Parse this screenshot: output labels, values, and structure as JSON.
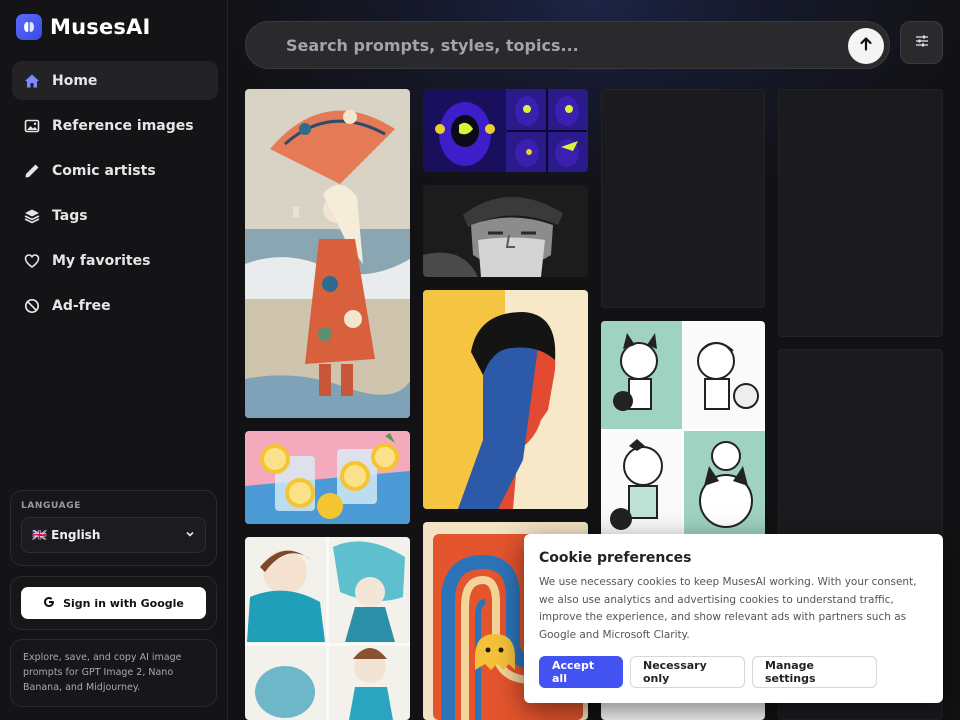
{
  "brand": {
    "name": "MusesAI"
  },
  "nav": [
    {
      "label": "Home",
      "icon": "home-icon",
      "active": true
    },
    {
      "label": "Reference images",
      "icon": "image-icon"
    },
    {
      "label": "Comic artists",
      "icon": "pencil-icon"
    },
    {
      "label": "Tags",
      "icon": "layers-icon"
    },
    {
      "label": "My favorites",
      "icon": "heart-icon"
    },
    {
      "label": "Ad-free",
      "icon": "ban-icon"
    }
  ],
  "language": {
    "label": "LANGUAGE",
    "selected": "🇬🇧 English"
  },
  "auth": {
    "signin_label": "Sign in with Google"
  },
  "about": {
    "text": "Explore, save, and copy AI image prompts for GPT Image 2, Nano Banana, and Midjourney."
  },
  "search": {
    "placeholder": "Search prompts, styles, topics..."
  },
  "cookie": {
    "title": "Cookie preferences",
    "text": "We use necessary cookies to keep MusesAI working. With your consent, we also use analytics and advertising cookies to understand traffic, improve the experience, and show relevant ads with partners such as Google and Microsoft Clarity.",
    "accept_label": "Accept all",
    "necessary_label": "Necessary only",
    "manage_label": "Manage settings"
  },
  "colors": {
    "accent": "#4353f2",
    "sidebar_bg": "#141416",
    "page_bg": "#121214"
  }
}
